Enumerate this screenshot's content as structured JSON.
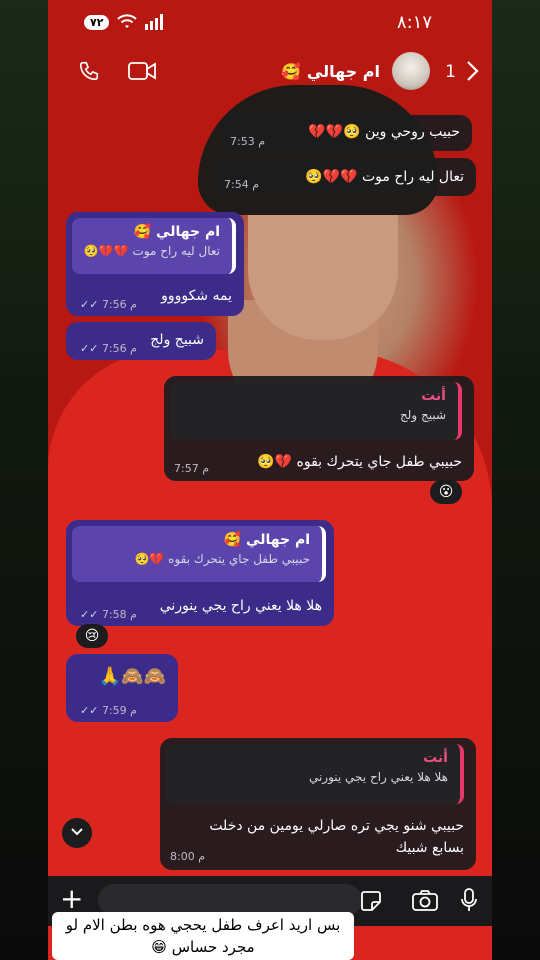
{
  "status_bar": {
    "time": "٨:١٧",
    "battery": "٧٢"
  },
  "header": {
    "contact_name": "ام جهالي 🥰",
    "unread_count": "1"
  },
  "messages": [
    {
      "text": "حبيب روحي وين 🥺💔💔",
      "time": "7:53 م"
    },
    {
      "text": "تعال ليه راح موت 💔💔🥺",
      "time": "7:54 م"
    },
    {
      "reply_name": "ام جهالي 🥰",
      "reply_text": "تعال ليه راح موت 💔💔🥺",
      "text": "يمه شكوووو",
      "time": "7:56 م"
    },
    {
      "text": "شبيج ولج",
      "time": "7:56 م"
    },
    {
      "reply_name": "أنت",
      "reply_text": "شبيج ولج",
      "text": "حبيبي طفل جاي يتحرك بقوه 💔🥺",
      "time": "7:57 م",
      "reaction": "😮"
    },
    {
      "reply_name": "ام جهالي 🥰",
      "reply_text": "حبيبي طفل جاي يتحرك بقوه 💔🥺",
      "text": "هلا هلا يعني راح يجي ينورني",
      "time": "7:58 م",
      "reaction": "😢"
    },
    {
      "text": "🙈🙈🙏",
      "time": "7:59 م"
    },
    {
      "reply_name": "أنت",
      "reply_text": "هلا هلا يعني راح يجي ينورني",
      "text_line1": "حبيبي شنو يجي تره صارلي يومين من دخلت",
      "text_line2": "بسابع شبيك",
      "time": "8:00 م"
    }
  ],
  "caption": {
    "line1": "بس اريد اعرف طفل يحجي هوه بطن الام لو",
    "line2": "مجرد حساس 😁"
  },
  "colors": {
    "incoming": "#1c1c1e",
    "outgoing": "#3d2b8a",
    "you_accent": "#e7386e"
  }
}
